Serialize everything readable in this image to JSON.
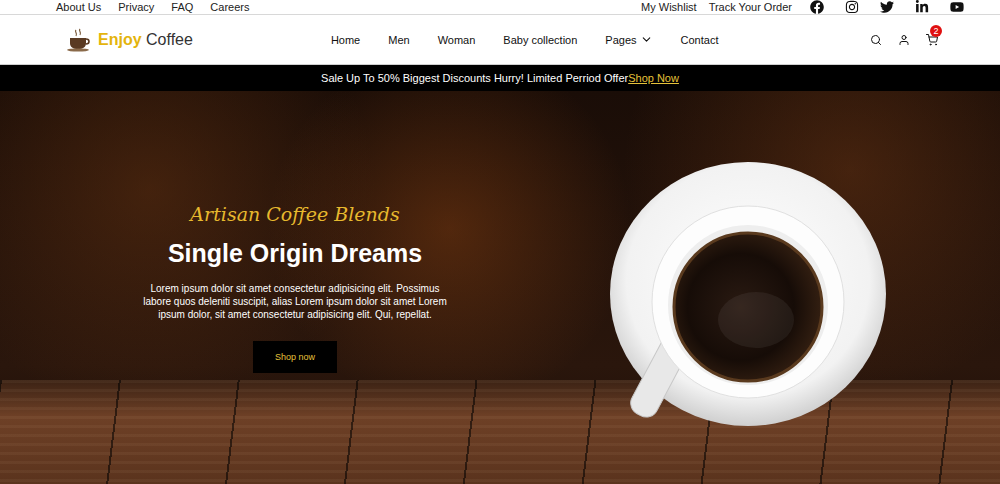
{
  "top_bar": {
    "links": [
      "About Us",
      "Privacy",
      "FAQ",
      "Careers"
    ],
    "account_links": [
      "My Wishlist",
      "Track Your Order"
    ]
  },
  "logo": {
    "brand": "Enjoy",
    "name": "Coffee"
  },
  "nav": {
    "items": [
      {
        "label": "Home",
        "has_menu": false
      },
      {
        "label": "Men",
        "has_menu": false
      },
      {
        "label": "Woman",
        "has_menu": false
      },
      {
        "label": "Baby collection",
        "has_menu": false
      },
      {
        "label": "Pages",
        "has_menu": true
      },
      {
        "label": "Contact",
        "has_menu": false
      }
    ]
  },
  "cart": {
    "count": "2"
  },
  "promo": {
    "text": "Sale Up To 50% Biggest Discounts Hurry! Limited Perriod Offer",
    "link": "Shop Now"
  },
  "hero": {
    "eyebrow": "Artisan Coffee Blends",
    "title": "Single Origin Dreams",
    "body": "Lorem ipsum dolor sit amet consectetur adipisicing elit. Possimus labore quos deleniti suscipit, alias Lorem ipsum dolor sit amet Lorem ipsum dolor, sit amet consectetur adipisicing elit. Qui, repellat.",
    "button": "Shop now"
  }
}
